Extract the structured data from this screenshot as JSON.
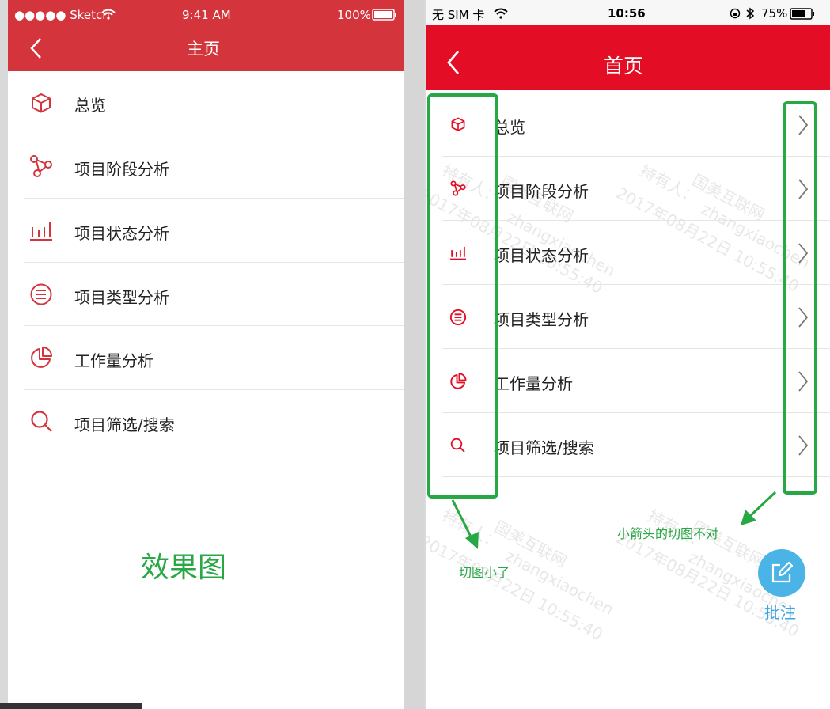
{
  "left": {
    "status": {
      "carrier": "●●●●● Sketch",
      "time": "9:41 AM",
      "battery": "100%"
    },
    "title": "主页",
    "items": [
      {
        "icon": "cube-icon",
        "label": "总览"
      },
      {
        "icon": "share-nodes-icon",
        "label": "项目阶段分析"
      },
      {
        "icon": "bar-chart-icon",
        "label": "项目状态分析"
      },
      {
        "icon": "list-circle-icon",
        "label": "项目类型分析"
      },
      {
        "icon": "pie-chart-icon",
        "label": "工作量分析"
      },
      {
        "icon": "search-icon",
        "label": "项目筛选/搜索"
      }
    ],
    "caption": "效果图"
  },
  "right": {
    "status": {
      "carrier": "无 SIM 卡",
      "time": "10:56",
      "battery": "75%"
    },
    "title": "首页",
    "items": [
      {
        "icon": "cube-icon",
        "label": "总览"
      },
      {
        "icon": "share-nodes-icon",
        "label": "项目阶段分析"
      },
      {
        "icon": "bar-chart-icon",
        "label": "项目状态分析"
      },
      {
        "icon": "list-circle-icon",
        "label": "项目类型分析"
      },
      {
        "icon": "pie-chart-icon",
        "label": "工作量分析"
      },
      {
        "icon": "search-icon",
        "label": "项目筛选/搜索"
      }
    ],
    "watermark": {
      "line1": "持有人：",
      "line2": "国美互联网",
      "line3": "2017年08月22日 10:55:40",
      "user": "zhangxiaochen"
    },
    "annotations": {
      "icons": "切图小了",
      "arrows": "小箭头的切图不对"
    },
    "fab_label": "批注"
  },
  "colors": {
    "left_red": "#d4343b",
    "right_red": "#e30e25",
    "annotation_green": "#28a745",
    "fab_blue": "#4ab4e6"
  }
}
